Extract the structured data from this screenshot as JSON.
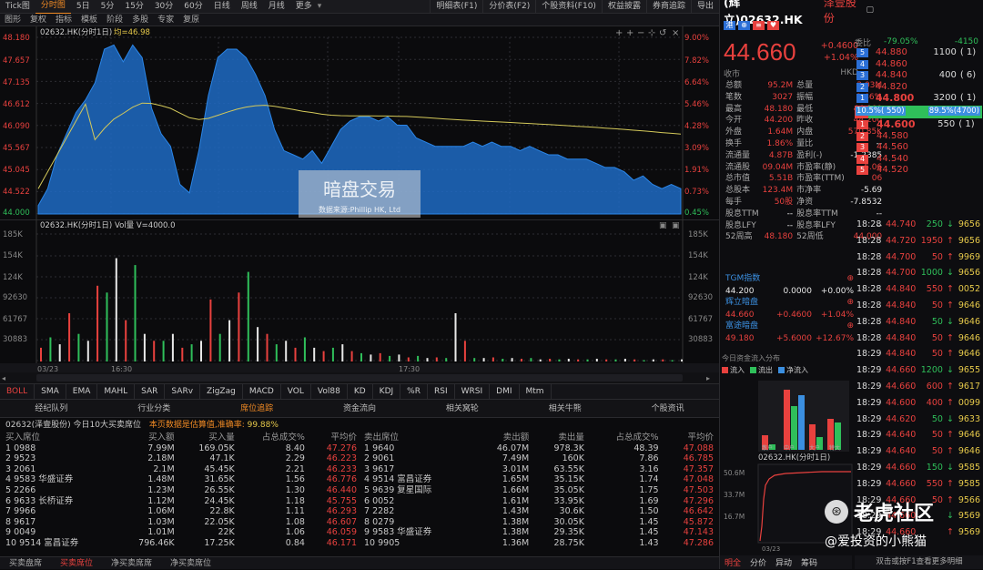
{
  "topbar": {
    "tabs": [
      "Tick图",
      "分时图",
      "5日",
      "5分",
      "15分",
      "30分",
      "60分",
      "日线",
      "周线",
      "月线",
      "更多"
    ],
    "active": 1
  },
  "right_toolbar": [
    "明细表(F1)",
    "分价表(F2)",
    "个股资料(F10)",
    "权益披露",
    "券商追踪",
    "导出"
  ],
  "toolbar": [
    "图形",
    "复权",
    "指标",
    "模板",
    "阶段",
    "多股",
    "专家",
    "复原"
  ],
  "main": {
    "legend_code": "02632.HK(分时1日)",
    "legend_avg": "均=46.98",
    "price_ticks": [
      "48.180",
      "47.657",
      "47.135",
      "46.612",
      "46.090",
      "45.567",
      "45.045",
      "44.522",
      "44.000"
    ],
    "pct_ticks": [
      "9.00%",
      "7.82%",
      "6.64%",
      "5.46%",
      "4.28%",
      "3.09%",
      "1.91%",
      "0.73%",
      "0.45%"
    ],
    "watermark": "暗盘交易",
    "watermark_sub": "数据来源:Phillip HK, Ltd"
  },
  "vol": {
    "legend": "02632.HK(分时1日) Vol量 V=4000.0",
    "ticks": [
      "185K",
      "154K",
      "124K",
      "92630",
      "61767",
      "30883"
    ],
    "time_labels": [
      "03/23",
      "16:30",
      "17:30"
    ]
  },
  "indicators": [
    "BOLL",
    "SMA",
    "EMA",
    "MAHL",
    "SAR",
    "SARv",
    "ZigZag",
    "MACD",
    "VOL",
    "Vol88",
    "KD",
    "KDJ",
    "%R",
    "RSI",
    "WRSI",
    "DMI",
    "Mtm"
  ],
  "subtabs": [
    "经纪队列",
    "行业分类",
    "席位追踪",
    "资金流向",
    "相关窝轮",
    "相关牛熊",
    "个股资讯"
  ],
  "subtab_active": 2,
  "summary": {
    "prefix": "02632(泽壹股份)   今日10大买卖席位",
    "note": "本页数据是估算值,准确率: ",
    "accuracy": "99.88%"
  },
  "buy_table": {
    "headers": [
      "买入席位",
      "买入额",
      "买入量",
      "占总成交%",
      "平均价"
    ],
    "rows": [
      [
        "1",
        "0988",
        "",
        "7.99M",
        "169.05K",
        "8.40",
        "47.276"
      ],
      [
        "2",
        "9523",
        "",
        "2.18M",
        "47.1K",
        "2.29",
        "46.223"
      ],
      [
        "3",
        "2061",
        "",
        "2.1M",
        "45.45K",
        "2.21",
        "46.233"
      ],
      [
        "4",
        "9583",
        "华盛证券",
        "1.48M",
        "31.65K",
        "1.56",
        "46.776"
      ],
      [
        "5",
        "2266",
        "",
        "1.23M",
        "26.55K",
        "1.30",
        "46.440"
      ],
      [
        "6",
        "9633",
        "长桥证券",
        "1.12M",
        "24.45K",
        "1.18",
        "45.755"
      ],
      [
        "7",
        "9966",
        "",
        "1.06M",
        "22.8K",
        "1.11",
        "46.293"
      ],
      [
        "8",
        "9617",
        "",
        "1.03M",
        "22.05K",
        "1.08",
        "46.607"
      ],
      [
        "9",
        "0049",
        "",
        "1.01M",
        "22K",
        "1.06",
        "46.059"
      ],
      [
        "10",
        "9514",
        "富昌证券",
        "796.46K",
        "17.25K",
        "0.84",
        "46.171"
      ]
    ]
  },
  "sell_table": {
    "headers": [
      "卖出席位",
      "卖出额",
      "卖出量",
      "占总成交%",
      "平均价"
    ],
    "rows": [
      [
        "1",
        "9640",
        "",
        "46.07M",
        "978.3K",
        "48.39",
        "47.088"
      ],
      [
        "2",
        "9061",
        "",
        "7.49M",
        "160K",
        "7.86",
        "46.785"
      ],
      [
        "3",
        "9617",
        "",
        "3.01M",
        "63.55K",
        "3.16",
        "47.357"
      ],
      [
        "4",
        "9514",
        "富昌证券",
        "1.65M",
        "35.15K",
        "1.74",
        "47.048"
      ],
      [
        "5",
        "9639",
        "复星国际",
        "1.66M",
        "35.05K",
        "1.75",
        "47.503"
      ],
      [
        "6",
        "0052",
        "",
        "1.61M",
        "33.95K",
        "1.69",
        "47.296"
      ],
      [
        "7",
        "2282",
        "",
        "1.43M",
        "30.6K",
        "1.50",
        "46.642"
      ],
      [
        "8",
        "0279",
        "",
        "1.38M",
        "30.05K",
        "1.45",
        "45.872"
      ],
      [
        "9",
        "9583",
        "华盛证券",
        "1.38M",
        "29.35K",
        "1.45",
        "47.143"
      ],
      [
        "10",
        "9905",
        "",
        "1.36M",
        "28.75K",
        "1.43",
        "47.286"
      ]
    ]
  },
  "bottomtabs": [
    "买卖盘席",
    "买卖席位",
    "净买卖席席",
    "净买卖席位"
  ],
  "bottom_active": 1,
  "quote": {
    "title": "(辉立)02632.HK",
    "name": "泽壹股份",
    "price": "44.660",
    "chg": "+0.4600",
    "chg_pct": "+1.04%",
    "close_label": "收市",
    "currency": "HKD",
    "stats": [
      [
        "总额",
        "95.2M",
        "总量",
        "2.03M"
      ],
      [
        "笔数",
        "3027",
        "振幅",
        "9.46%"
      ],
      [
        "最高",
        "48.180",
        "最低",
        "44.000"
      ],
      [
        "今开",
        "44.200",
        "昨收",
        "44.200"
      ],
      [
        "外盘",
        "1.64M",
        "内盘",
        "570.85K"
      ],
      [
        "换手",
        "1.86%",
        "量比",
        "--"
      ],
      [
        "流通量",
        "4.87B",
        "盈利(-)",
        "-1.2385"
      ],
      [
        "流通股",
        "09.04M",
        "市盈率(静)",
        "6.06"
      ],
      [
        "总市值",
        "5.51B",
        "市盈率(TTM)",
        "06"
      ],
      [
        "总股本",
        "123.4M",
        "市净率",
        "-5.69"
      ],
      [
        "每手",
        "50股",
        "净资",
        "-7.8532"
      ],
      [
        "股息TTM",
        "--",
        "股息率TTM",
        "--"
      ],
      [
        "股息LFY",
        "--",
        "股息率LFY",
        "--"
      ],
      [
        "52周高",
        "48.180",
        "52周低",
        "44.000"
      ]
    ]
  },
  "orderbook": {
    "weibi_label": "委比",
    "weibi": "-79.05%",
    "weicha": "-4150",
    "asks": [
      [
        "5",
        "44.880",
        "1100",
        "( 1)"
      ],
      [
        "4",
        "44.860",
        "",
        ""
      ],
      [
        "3",
        "44.840",
        "400",
        "( 6)"
      ],
      [
        "2",
        "44.820",
        "",
        ""
      ],
      [
        "1",
        "44.800",
        "3200",
        "( 1)"
      ]
    ],
    "bar_left": "10.5%( 550)",
    "bar_right": "89.5%(4700)",
    "bar_left_pct": 10.5,
    "bids": [
      [
        "1",
        "44.600",
        "550",
        "( 1)"
      ],
      [
        "2",
        "44.580",
        "",
        ""
      ],
      [
        "3",
        "44.560",
        "",
        ""
      ],
      [
        "4",
        "44.540",
        "",
        ""
      ],
      [
        "5",
        "44.520",
        "",
        ""
      ]
    ]
  },
  "ticks": [
    [
      "18:28",
      "44.740",
      "250",
      "9656"
    ],
    [
      "18:28",
      "44.720",
      "1950",
      "9656"
    ],
    [
      "18:28",
      "44.700",
      "50",
      "9969"
    ],
    [
      "18:28",
      "44.700",
      "1000",
      "9656"
    ],
    [
      "18:28",
      "44.840",
      "550",
      "0052"
    ],
    [
      "18:28",
      "44.840",
      "50",
      "9646"
    ],
    [
      "18:28",
      "44.840",
      "50",
      "9646"
    ],
    [
      "18:28",
      "44.840",
      "50",
      "9646"
    ],
    [
      "18:29",
      "44.840",
      "50",
      "9646"
    ],
    [
      "18:29",
      "44.660",
      "1200",
      "9655"
    ],
    [
      "18:29",
      "44.660",
      "600",
      "9617"
    ],
    [
      "18:29",
      "44.600",
      "400",
      "0099"
    ],
    [
      "18:29",
      "44.620",
      "50",
      "9633"
    ],
    [
      "18:29",
      "44.640",
      "50",
      "9646"
    ],
    [
      "18:29",
      "44.640",
      "50",
      "9646"
    ],
    [
      "18:29",
      "44.660",
      "150",
      "9585"
    ],
    [
      "18:29",
      "44.660",
      "550",
      "9585"
    ],
    [
      "18:29",
      "44.660",
      "50",
      "9566"
    ],
    [
      "18:29",
      "44.660",
      "",
      "9569"
    ],
    [
      "18:29",
      "44.660",
      "",
      "9569"
    ]
  ],
  "related": [
    {
      "name": "TGM指数",
      "price": "44.200",
      "chg": "0.0000",
      "pct": "+0.00%"
    },
    {
      "name": "辉立暗盘",
      "price": "44.660",
      "chg": "+0.4600",
      "pct": "+1.04%"
    },
    {
      "name": "富途暗盘",
      "price": "49.180",
      "chg": "+5.6000",
      "pct": "+12.67%"
    }
  ],
  "flow": {
    "title": "今日资金流入分布",
    "legend": [
      "流入",
      "流出",
      "净流入"
    ],
    "cats": [
      "散户",
      "中户",
      "大户",
      "特大"
    ]
  },
  "mini": {
    "title": "02632.HK(分时1日)",
    "ticks": [
      "50.6M",
      "33.7M",
      "16.7M"
    ],
    "time": "03/23"
  },
  "right_bottom": {
    "tabs": [
      "明全",
      "分价",
      "异动",
      "筹码"
    ],
    "hint": "双击或按F1查看更多明细"
  },
  "overlay": {
    "brand": "老虎社区",
    "handle": "@爱投资的小熊猫"
  },
  "price_series": [
    44.2,
    44.6,
    45.4,
    45.9,
    46.4,
    46.7,
    47.1,
    47.9,
    48.0,
    47.6,
    48.0,
    47.7,
    46.5,
    45.9,
    45.6,
    44.7,
    44.5,
    45.5,
    46.8,
    47.7,
    47.9,
    47.9,
    47.7,
    47.3,
    46.8,
    46.0,
    45.5,
    45.4,
    45.3,
    45.5,
    45.2,
    45.6,
    46.0,
    46.2,
    46.3,
    46.3,
    46.2,
    46.3,
    46.1,
    46.1,
    45.8,
    45.7,
    45.6,
    45.6,
    45.6,
    45.6,
    45.7,
    45.6,
    45.7,
    45.6,
    45.6,
    45.5,
    45.6,
    45.5,
    45.4,
    45.4,
    45.3,
    45.3,
    45.3,
    45.2,
    45.1,
    45.1,
    45.0,
    44.8,
    44.9,
    44.7,
    44.6,
    44.7,
    44.6
  ],
  "vol_series": [
    20,
    35,
    25,
    70,
    40,
    30,
    110,
    100,
    150,
    60,
    140,
    40,
    30,
    30,
    40,
    20,
    25,
    30,
    90,
    40,
    60,
    100,
    130,
    50,
    40,
    25,
    30,
    20,
    35,
    20,
    15,
    20,
    25,
    15,
    12,
    10,
    12,
    8,
    10,
    6,
    8,
    5,
    6,
    5,
    70,
    30,
    5,
    5,
    6,
    4,
    5,
    4,
    5,
    3,
    4,
    3,
    4,
    3,
    3,
    4,
    3,
    3,
    4,
    3,
    2,
    3,
    3,
    2,
    3
  ],
  "series_colors": {
    "up": "#e8413e",
    "down": "#2fbf5a",
    "flat": "#e8e8e8",
    "area": "#1f6bc4",
    "avg": "#d4c95a"
  }
}
